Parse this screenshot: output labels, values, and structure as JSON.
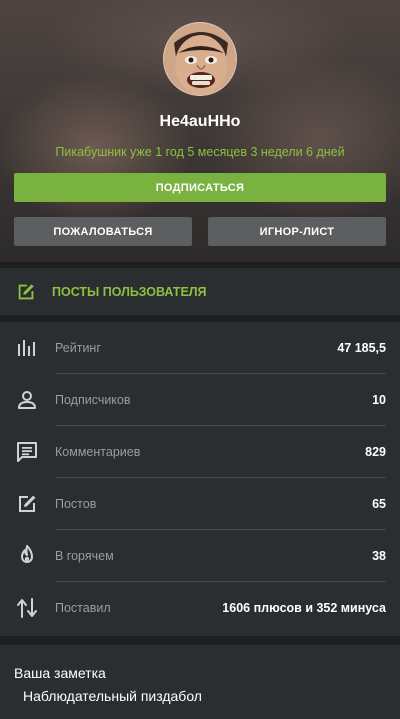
{
  "profile": {
    "username": "He4auHHo",
    "since": "Пикабушник уже 1 год 5 месяцев 3 недели 6 дней"
  },
  "actions": {
    "subscribe_label": "ПОДПИСАТЬСЯ",
    "report_label": "ПОЖАЛОВАТЬСЯ",
    "ignore_label": "ИГНОР-ЛИСТ"
  },
  "posts": {
    "label": "ПОСТЫ ПОЛЬЗОВАТЕЛЯ"
  },
  "stats": [
    {
      "icon": "rating-bars-icon",
      "label": "Рейтинг",
      "value": "47 185,5"
    },
    {
      "icon": "person-icon",
      "label": "Подписчиков",
      "value": "10"
    },
    {
      "icon": "comment-icon",
      "label": "Комментариев",
      "value": "829"
    },
    {
      "icon": "edit-icon",
      "label": "Постов",
      "value": "65"
    },
    {
      "icon": "flame-icon",
      "label": "В горячем",
      "value": "38"
    },
    {
      "icon": "up-down-arrows-icon",
      "label": "Поставил",
      "value": "1606 плюсов и 352 минуса"
    }
  ],
  "note": {
    "title": "Ваша заметка",
    "text": "Наблюдательный пиздабол"
  },
  "colors": {
    "accent": "#8cc23f",
    "button_green": "#79b23e",
    "button_gray": "#5c5e60",
    "panel": "#2b2e31",
    "background": "#1d1f21"
  }
}
